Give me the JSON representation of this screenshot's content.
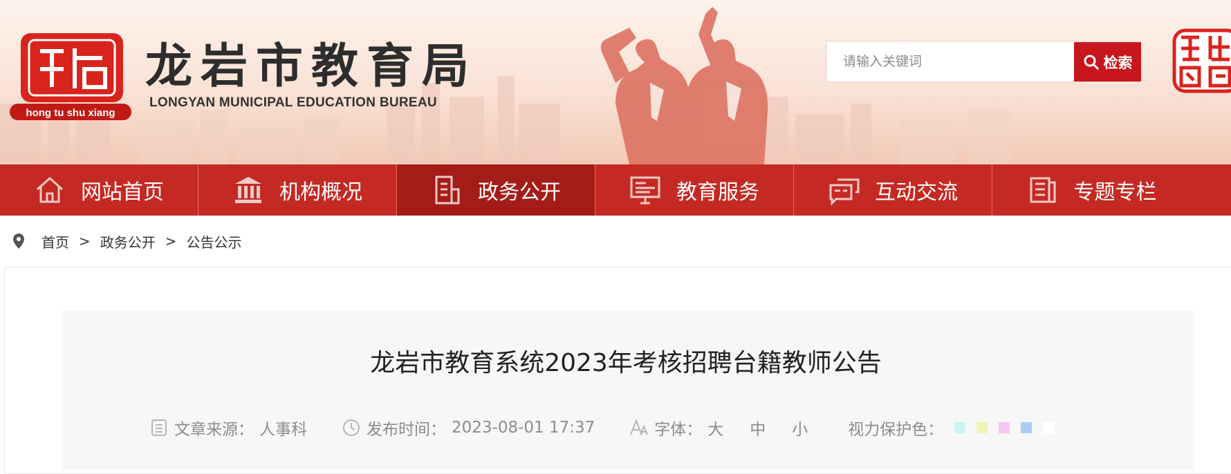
{
  "header": {
    "logo_badge": "hong tu shu xiang",
    "title": "龙岩市教育局",
    "subtitle": "LONGYAN MUNICIPAL EDUCATION BUREAU",
    "seal_text": "龍岩中國",
    "search": {
      "placeholder": "请输入关键词",
      "button_label": "检索"
    }
  },
  "nav": {
    "items": [
      {
        "label": "网站首页",
        "icon": "home-icon"
      },
      {
        "label": "机构概况",
        "icon": "institution-icon"
      },
      {
        "label": "政务公开",
        "icon": "document-icon",
        "active": true
      },
      {
        "label": "教育服务",
        "icon": "monitor-icon"
      },
      {
        "label": "互动交流",
        "icon": "chat-icon"
      },
      {
        "label": "专题专栏",
        "icon": "newspaper-icon"
      }
    ]
  },
  "breadcrumb": {
    "items": [
      "首页",
      "政务公开",
      "公告公示"
    ],
    "separator": ">"
  },
  "article": {
    "title": "龙岩市教育系统2023年考核招聘台籍教师公告",
    "source_label": "文章来源：",
    "source_value": "人事科",
    "time_label": "发布时间：",
    "time_value": "2023-08-01 17:37",
    "font_label": "字体：",
    "font_options": [
      "大",
      "中",
      "小"
    ],
    "eye_label": "视力保护色：",
    "eye_colors": [
      "#c9f5f7",
      "#f3f3b5",
      "#f7c6f3",
      "#a9cdf5",
      "#ffffff"
    ]
  },
  "colors": {
    "nav_bg": "#c52923",
    "nav_active": "#a41c17",
    "accent": "#c8161d"
  }
}
